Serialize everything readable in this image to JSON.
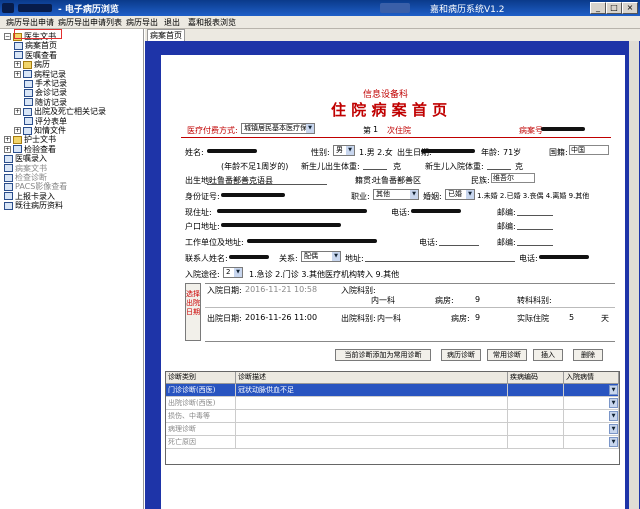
{
  "window": {
    "title": "- 电子病历浏览",
    "app_title": "嘉和病历系统V1.2",
    "min": "_",
    "max": "□",
    "close": "×"
  },
  "menu": [
    "病历导出申请",
    "病历导出申请列表",
    "病历导出",
    "退出",
    "嘉和报表浏览"
  ],
  "tree": [
    {
      "label": "医生文书",
      "level": 0,
      "expander": "⊟",
      "folder": true
    },
    {
      "label": "病案首页",
      "level": 1
    },
    {
      "label": "医嘱查看",
      "level": 1
    },
    {
      "label": "病历",
      "level": 1,
      "expander": "⊞",
      "folder": true
    },
    {
      "label": "病程记录",
      "level": 1,
      "expander": "⊞"
    },
    {
      "label": "手术记录",
      "level": 2
    },
    {
      "label": "会诊记录",
      "level": 2
    },
    {
      "label": "随访记录",
      "level": 2
    },
    {
      "label": "出院及死亡相关记录",
      "level": 1,
      "expander": "⊞"
    },
    {
      "label": "评分表单",
      "level": 2
    },
    {
      "label": "知情文件",
      "level": 1,
      "expander": "⊞"
    },
    {
      "label": "护士文书",
      "level": 0,
      "expander": "⊞",
      "folder": true
    },
    {
      "label": "检验查看",
      "level": 0,
      "expander": "⊞"
    },
    {
      "label": "医嘱录入",
      "level": 0
    },
    {
      "label": "病案文书",
      "level": 0,
      "gray": true
    },
    {
      "label": "检查诊断",
      "level": 0,
      "gray": true
    },
    {
      "label": "PACS影像查看",
      "level": 0,
      "gray": true
    },
    {
      "label": "上报卡录入",
      "level": 0
    },
    {
      "label": "既往病历资料",
      "level": 0
    }
  ],
  "tab": "病案首页",
  "form": {
    "hospital": "信息设备科",
    "title": "住 院 病 案 首 页",
    "pay_label": "医疗付费方式:",
    "pay_value": "城镇居民基本医疗保险",
    "times_label": "第",
    "times_value": "1",
    "times_suffix": "次住院",
    "case_no_label": "病案号",
    "name_label": "姓名:",
    "sex_label": "性别:",
    "sex_value": "男",
    "sex_hint": "1.男 2.女",
    "birth_label": "出生日期:",
    "age_label": "年龄:",
    "age_value": "71岁",
    "nation_label": "国籍:",
    "nation_value": "中国",
    "infant_age_label": "(年龄不足1周岁的)",
    "newborn_weight_label": "新生儿出生体重:",
    "gram": "克",
    "newborn_in_label": "新生儿入院体重:",
    "birthplace_label": "出生地:",
    "birthplace_value": "吐鲁番鄯善克语县",
    "native_label": "籍贯:",
    "native_value": "吐鲁番鄯善区",
    "ethnic_label": "民族:",
    "ethnic_value": "维吾尔",
    "id_label": "身份证号:",
    "job_label": "职业:",
    "job_value": "其他",
    "marriage_label": "婚姻:",
    "marriage_value": "已婚",
    "marriage_hint": "1.未婚 2.已婚 3.丧偶 4.离婚 9.其他",
    "current_addr_label": "现住址:",
    "phone_label": "电话:",
    "zip_label": "邮编:",
    "hukou_label": "户口地址:",
    "work_label": "工作单位及地址:",
    "contact_label": "联系人姓名:",
    "relation_label": "关系:",
    "relation_value": "配偶",
    "addr_label": "地址:",
    "admit_route_label": "入院途径:",
    "admit_route_value": "2",
    "admit_route_hint": "1.急诊 2.门诊 3.其他医疗机构转入 9.其他",
    "side_btn": "选择出院日期",
    "admit_date_label": "入院日期:",
    "admit_date_value": "2016-11-21 10:58",
    "admit_dept_label": "入院科别:",
    "admit_dept_value": "内一科",
    "ward_label": "病房:",
    "ward_value": "9",
    "transfer_label": "转科科别:",
    "discharge_date_label": "出院日期:",
    "discharge_date_value": "2016-11-26 11:00",
    "discharge_dept_label": "出院科别:",
    "discharge_dept_value": "内一科",
    "ward2_value": "9",
    "days_label": "实际住院",
    "days_value": "5",
    "days_unit": "天"
  },
  "buttons": [
    "当前诊断添加为常用诊断",
    "病历诊断",
    "常用诊断",
    "插入",
    "删除"
  ],
  "grid": {
    "headers": [
      "诊断类别",
      "诊断描述",
      "疾病编码",
      "入院病情"
    ],
    "rows": [
      {
        "type": "门诊诊断(西医)",
        "desc": "冠状动脉供血不足",
        "code": "",
        "status": ""
      },
      {
        "type": "出院诊断(西医)",
        "desc": "",
        "code": "",
        "status": ""
      },
      {
        "type": "损伤、中毒等",
        "desc": "",
        "code": "",
        "status": ""
      },
      {
        "type": "病理诊断",
        "desc": "",
        "code": "",
        "status": ""
      },
      {
        "type": "死亡原因",
        "desc": "",
        "code": "",
        "status": ""
      }
    ]
  },
  "colors": {
    "titlebar": "#1f5fc8",
    "form_bg": "#1e34a8",
    "accent_red": "#c00000",
    "selected_row": "#2854c0"
  }
}
